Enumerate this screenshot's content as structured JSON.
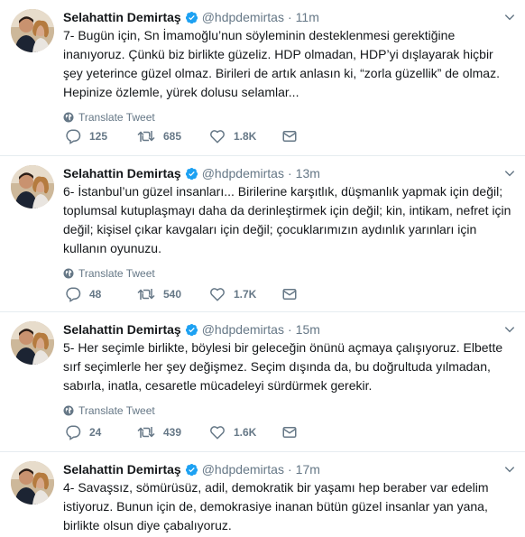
{
  "tweets": [
    {
      "name": "Selahattin Demirtaş",
      "handle": "@hdpdemirtas",
      "separator": "·",
      "time": "11m",
      "text": "7- Bugün için, Sn İmamoğlu’nun söyleminin desteklenmesi gerektiğine inanıyoruz. Çünkü biz birlikte güzeliz. HDP olmadan, HDP’yi dışlayarak hiçbir şey yeterince güzel olmaz. Birileri de artık anlasın ki, “zorla güzellik” de olmaz. Hepinize özlemle, yürek dolusu selamlar...",
      "translate": "Translate Tweet",
      "replies": "125",
      "retweets": "685",
      "likes": "1.8K"
    },
    {
      "name": "Selahattin Demirtaş",
      "handle": "@hdpdemirtas",
      "separator": "·",
      "time": "13m",
      "text": "6- İstanbul’un güzel insanları... Birilerine karşıtlık, düşmanlık yapmak için değil; toplumsal kutuplaşmayı daha da derinleştirmek için değil; kin, intikam, nefret için değil; kişisel çıkar kavgaları için değil; çocuklarımızın aydınlık yarınları için kullanın oyunuzu.",
      "translate": "Translate Tweet",
      "replies": "48",
      "retweets": "540",
      "likes": "1.7K"
    },
    {
      "name": "Selahattin Demirtaş",
      "handle": "@hdpdemirtas",
      "separator": "·",
      "time": "15m",
      "text": "5- Her seçimle birlikte, böylesi bir geleceğin önünü açmaya çalışıyoruz. Elbette sırf seçimlerle her şey değişmez. Seçim dışında da, bu doğrultuda yılmadan, sabırla, inatla, cesaretle mücadeleyi sürdürmek gerekir.",
      "translate": "Translate Tweet",
      "replies": "24",
      "retweets": "439",
      "likes": "1.6K"
    },
    {
      "name": "Selahattin Demirtaş",
      "handle": "@hdpdemirtas",
      "separator": "·",
      "time": "17m",
      "text": "4- Savaşsız, sömürüsüz, adil, demokratik bir yaşamı hep beraber var edelim istiyoruz. Bunun için de, demokrasiye inanan bütün güzel insanlar yan yana, birlikte olsun diye çabalıyoruz.",
      "translate": "",
      "replies": "",
      "retweets": "",
      "likes": ""
    }
  ],
  "colors": {
    "verified": "#1da1f2",
    "muted": "#657786",
    "text": "#14171a",
    "divider": "#e6ecf0"
  }
}
